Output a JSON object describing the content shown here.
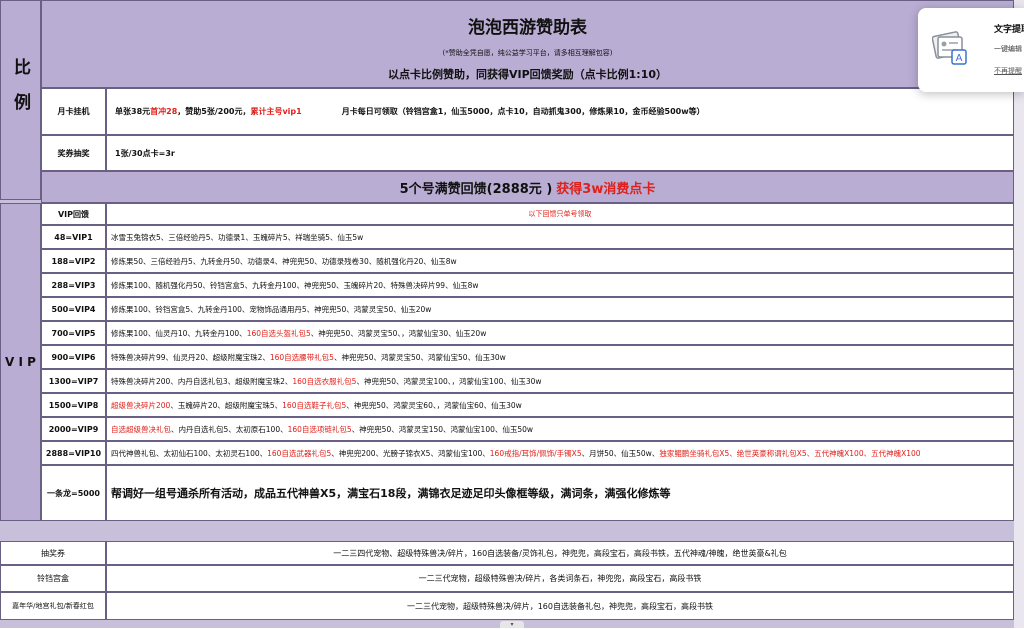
{
  "header": {
    "title": "泡泡西游赞助表",
    "notice": "(*赞助全凭自愿，纯公益学习平台，请多相互理解包容)",
    "ratio_line": "以点卡比例赞助，同获得VIP回馈奖励（点卡比例1:10）"
  },
  "ratio_section": {
    "label": "比例",
    "monthly": {
      "label": "月卡挂机",
      "seg1": "单张38元",
      "seg2": "首冲28",
      "seg3": "，赞助5张/200元，",
      "seg4": "累计主号vip1",
      "seg5": "月卡每日可领取（铃铛宫盒1，仙玉5000，点卡10，自动抓鬼300，修炼果10，金币经验500w等）"
    },
    "lottery": {
      "label": "奖券抽奖",
      "value": "1张/30点卡=3r"
    }
  },
  "full_banner": {
    "part1": "5个号满赞回馈(2888元 ) ",
    "part2": "获得3w消费点卡"
  },
  "vip": {
    "side_letters": [
      "V",
      "I",
      "P"
    ],
    "header_label": "VIP回馈",
    "header_note": "以下回馈只单号领取",
    "rows": [
      {
        "label": "48=VIP1",
        "segments": [
          {
            "text": "冰雪玉兔锦衣5、三倍经验丹5、功德录1、玉魄碎片5、祥瑞坐骑5、仙玉5w",
            "red": false
          }
        ]
      },
      {
        "label": "188=VIP2",
        "segments": [
          {
            "text": "修炼果50、三倍经验丹5、九转金丹50、功德录4、神兜兜50、功德录残卷30、随机强化丹20、仙玉8w",
            "red": false
          }
        ]
      },
      {
        "label": "288=VIP3",
        "segments": [
          {
            "text": "修炼果100、随机强化丹50、铃铛宫盒5、九转金丹100、神兜兜50、玉魄碎片20、特殊兽决碎片99、仙玉8w",
            "red": false
          }
        ]
      },
      {
        "label": "500=VIP4",
        "segments": [
          {
            "text": "修炼果100、铃铛宫盒5、九转金丹100、宠物饰品通用丹5、神兜兜50、鸿蒙灵宝50、仙玉20w",
            "red": false
          }
        ]
      },
      {
        "label": "700=VIP5",
        "segments": [
          {
            "text": "修炼果100、仙灵丹10、九转金丹100、",
            "red": false
          },
          {
            "text": "160自选头盔礼包5",
            "red": true
          },
          {
            "text": "、神兜兜50、鸿蒙灵宝50、，鸿蒙仙宝30、仙玉20w",
            "red": false
          }
        ]
      },
      {
        "label": "900=VIP6",
        "segments": [
          {
            "text": "特殊兽决碎片99、仙灵丹20、超级附魔宝珠2、",
            "red": false
          },
          {
            "text": "160自选腰带礼包5",
            "red": true
          },
          {
            "text": "、神兜兜50、鸿蒙灵宝50、鸿蒙仙宝50、仙玉30w",
            "red": false
          }
        ]
      },
      {
        "label": "1300=VIP7",
        "segments": [
          {
            "text": "特殊兽决碎片200、内丹自选礼包3、超级附魔宝珠2、",
            "red": false
          },
          {
            "text": "160自选衣服礼包5",
            "red": true
          },
          {
            "text": "、神兜兜50、鸿蒙灵宝100、，鸿蒙仙宝100、仙玉30w",
            "red": false
          }
        ]
      },
      {
        "label": "1500=VIP8",
        "segments": [
          {
            "text": "超级兽决碎片200",
            "red": true
          },
          {
            "text": "、玉魄碎片20、超级附魔宝珠5、",
            "red": false
          },
          {
            "text": "160自选鞋子礼包5",
            "red": true
          },
          {
            "text": "、神兜兜50、鸿蒙灵宝60、，鸿蒙仙宝60、仙玉30w",
            "red": false
          }
        ]
      },
      {
        "label": "2000=VIP9",
        "segments": [
          {
            "text": "自选超级兽决礼包",
            "red": true
          },
          {
            "text": "、内丹自选礼包5、太初原石100、",
            "red": false
          },
          {
            "text": "160自选项链礼包5",
            "red": true
          },
          {
            "text": "、神兜兜50、鸿蒙灵宝150、鸿蒙仙宝100、仙玉50w",
            "red": false
          }
        ]
      },
      {
        "label": "2888=VIP10",
        "segments": [
          {
            "text": "四代神兽礼包、太初仙石100、太初灵石100、",
            "red": false
          },
          {
            "text": "160自选武器礼包5",
            "red": true
          },
          {
            "text": "、神兜兜200、光膀子锦衣X5、鸿蒙仙宝100、",
            "red": false
          },
          {
            "text": "160戒指/耳饰/佩饰/手镯X5",
            "red": true
          },
          {
            "text": "、月饼50、仙玉50w、",
            "red": false
          },
          {
            "text": "独家鲲鹏坐骑礼包X5、绝世英豪称谓礼包X5、五代神魄X100、五代神魄X100",
            "red": true
          }
        ]
      }
    ],
    "dragon": {
      "label": "一条龙=5000",
      "value": "帮调好一组号通杀所有活动，成品五代神兽X5，满宝石18段，满锦衣足迹足印头像框等级，满词条，满强化修炼等"
    }
  },
  "bottom_rows": [
    {
      "label": "抽奖券",
      "value": "一二三四代宠物、超级特殊兽决/碎片，160自选装备/灵饰礼包，神兜兜，高段宝石，高段书铁，五代神魂/神魄，绝世英豪&礼包"
    },
    {
      "label": "铃铛宫盒",
      "value": "一二三代宠物，超级特殊兽决/碎片，各类词条石，神兜兜，高段宝石，高段书铁"
    },
    {
      "label": "嘉年华/地宫礼包/新春红包",
      "value": "一二三代宠物，超级特殊兽决/碎片，160自选装备礼包，神兜兜，高段宝石，高段书铁"
    }
  ],
  "popup": {
    "title": "文字提取",
    "line1": "一键编辑",
    "line2": "不再提醒"
  },
  "colors": {
    "red": "#e0201a",
    "purple_band": "#b9add3",
    "border": "#6a5f84"
  }
}
